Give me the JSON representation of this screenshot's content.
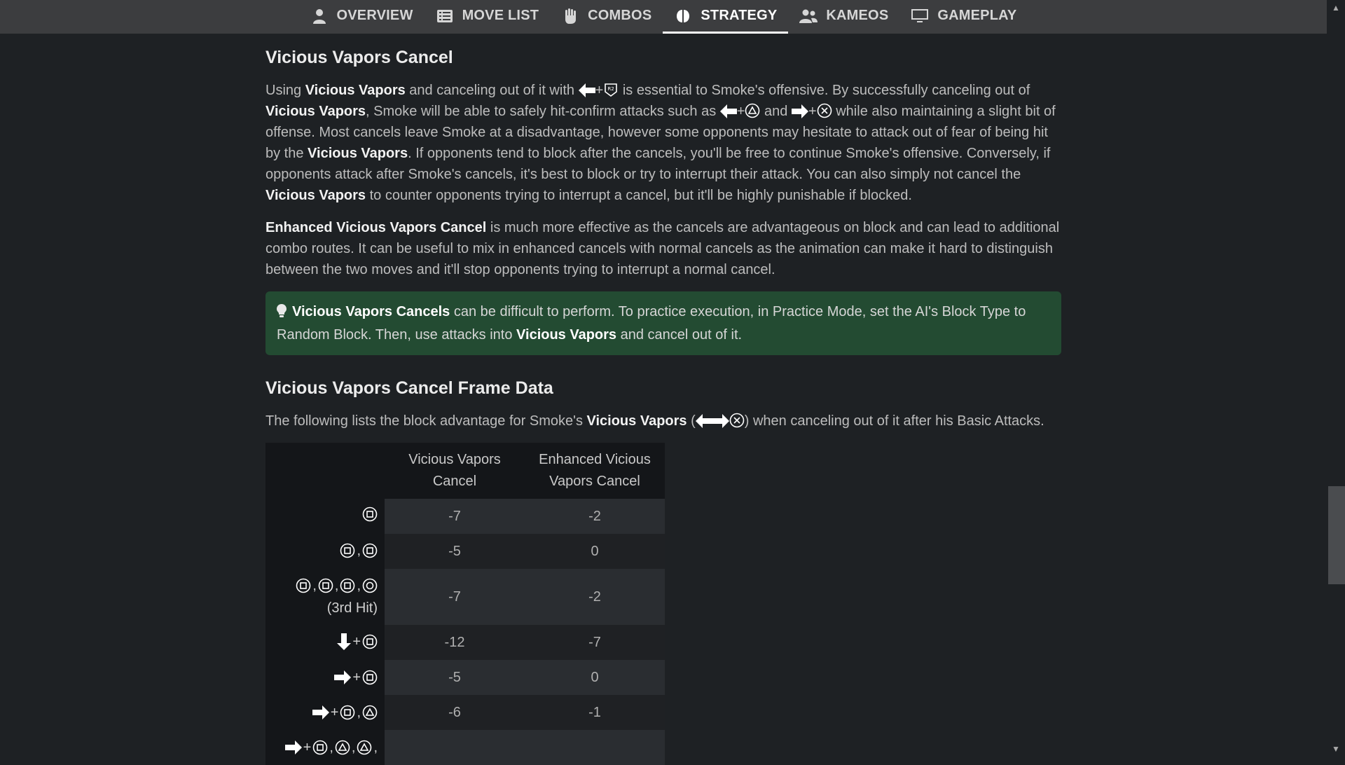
{
  "nav": {
    "tabs": [
      {
        "label": "OVERVIEW",
        "icon": "person-icon",
        "active": false
      },
      {
        "label": "MOVE LIST",
        "icon": "list-icon",
        "active": false
      },
      {
        "label": "COMBOS",
        "icon": "fist-icon",
        "active": false
      },
      {
        "label": "STRATEGY",
        "icon": "brain-icon",
        "active": true
      },
      {
        "label": "KAMEOS",
        "icon": "users-icon",
        "active": false
      },
      {
        "label": "GAMEPLAY",
        "icon": "monitor-icon",
        "active": false
      }
    ]
  },
  "section_cancel": {
    "title": "Vicious Vapors Cancel",
    "p1": {
      "t1": "Using ",
      "b1": "Vicious Vapors",
      "t2": " and canceling out of it with ",
      "t3": " is essential to Smoke's offensive. By successfully canceling out of ",
      "b2": "Vicious Vapors",
      "t4": ", Smoke will be able to safely hit-confirm attacks such as ",
      "t5": " and ",
      "t6": " while also maintaining a slight bit of offense. Most cancels leave Smoke at a disadvantage, however some opponents may hesitate to attack out of fear of being hit by the ",
      "b3": "Vicious Vapors",
      "t7": ". If opponents tend to block after the cancels, you'll be free to continue Smoke's offensive. Conversely, if opponents attack after Smoke's cancels, it's best to block or try to interrupt their attack. You can also simply not cancel the ",
      "b4": "Vicious Vapors",
      "t8": " to counter opponents trying to interrupt a cancel, but it'll be highly punishable if blocked."
    },
    "p2": {
      "b1": "Enhanced Vicious Vapors Cancel",
      "t1": " is much more effective as the cancels are advantageous on block and can lead to additional combo routes. It can be useful to mix in enhanced cancels with normal cancels as the animation can make it hard to distinguish between the two moves and it'll stop opponents trying to interrupt a normal cancel."
    },
    "tip": {
      "b1": "Vicious Vapors Cancels",
      "t1": " can be difficult to perform. To practice execution, in Practice Mode, set the AI's Block Type to Random Block. Then, use attacks into ",
      "b2": "Vicious Vapors",
      "t2": " and cancel out of it."
    }
  },
  "section_frame": {
    "title": "Vicious Vapors Cancel Frame Data",
    "intro": {
      "t1": "The following lists the block advantage for Smoke's ",
      "b1": "Vicious Vapors",
      "t2": " (",
      "t3": ") when canceling out of it after his Basic Attacks."
    },
    "table": {
      "headers": [
        "Vicious Vapors Cancel",
        "Enhanced Vicious Vapors Cancel"
      ],
      "rows": [
        {
          "note": "",
          "cancel": "-7",
          "enhanced": "-2"
        },
        {
          "note": "",
          "cancel": "-5",
          "enhanced": "0"
        },
        {
          "note": "(3rd Hit)",
          "cancel": "-7",
          "enhanced": "-2"
        },
        {
          "note": "",
          "cancel": "-12",
          "enhanced": "-7"
        },
        {
          "note": "",
          "cancel": "-5",
          "enhanced": "0"
        },
        {
          "note": "",
          "cancel": "-6",
          "enhanced": "-1"
        },
        {
          "note": "",
          "cancel": "",
          "enhanced": ""
        }
      ]
    }
  },
  "colors": {
    "background": "#1e2124",
    "nav_bg": "#3c3d3f",
    "tip_bg": "#234b32",
    "table_header_bg": "#141619"
  }
}
